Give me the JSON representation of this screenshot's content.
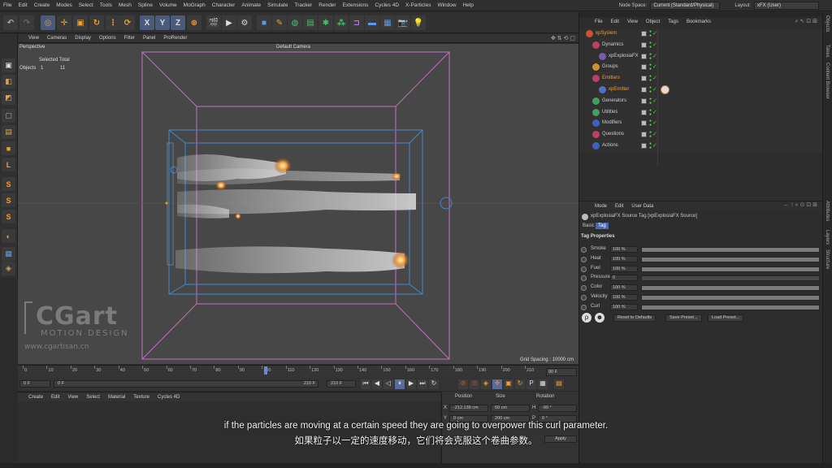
{
  "menubar": {
    "items": [
      "File",
      "Edit",
      "Create",
      "Modes",
      "Select",
      "Tools",
      "Mesh",
      "Spline",
      "Volume",
      "MoGraph",
      "Character",
      "Animate",
      "Simulate",
      "Tracker",
      "Render",
      "Extensions",
      "Cycles 4D",
      "X-Particles",
      "Window",
      "Help"
    ],
    "node_space_label": "Node Space:",
    "node_space_value": "Current (Standard/Physical)",
    "layout_label": "Layout:",
    "layout_value": "xFX (User)"
  },
  "toolbar": {
    "axis_labels": [
      "X",
      "Y",
      "Z"
    ]
  },
  "viewport": {
    "menu": [
      "View",
      "Cameras",
      "Display",
      "Options",
      "Filter",
      "Panel",
      "ProRender"
    ],
    "name": "Perspective",
    "camera": "Default Camera",
    "stats_header": "Selected Total",
    "stats_row_label": "Objects",
    "stats_selected": "1",
    "stats_total": "11",
    "grid_spacing": "Grid Spacing : 10000 cm"
  },
  "watermark": {
    "brand": "CGart",
    "tagline": "MOTION DESIGN",
    "url": "www.cgartisan.cn"
  },
  "timeline": {
    "ticks": [
      "0",
      "10",
      "20",
      "30",
      "40",
      "50",
      "60",
      "70",
      "80",
      "90",
      "100",
      "110",
      "120",
      "130",
      "140",
      "150",
      "160",
      "170",
      "180",
      "190",
      "200",
      "210"
    ],
    "current_frame_readout": "90 F",
    "start_frame": "0 F",
    "current_frame": "0 F",
    "end_frame": "210 F",
    "end_frame2": "210 F"
  },
  "bottom_menu": [
    "Create",
    "Edit",
    "View",
    "Select",
    "Material",
    "Texture",
    "Cycles 4D"
  ],
  "coords": {
    "headers": [
      "Position",
      "Size",
      "Rotation"
    ],
    "x_pos": "-212.139 cm",
    "x_size": "50 cm",
    "h_rot": "-90 °",
    "y_pos": "0 cm",
    "y_size": "200 cm",
    "p_rot": "0 °",
    "apply": "Apply"
  },
  "object_manager": {
    "menu": [
      "File",
      "Edit",
      "View",
      "Object",
      "Tags",
      "Bookmarks"
    ],
    "objects": [
      {
        "name": "xpSystem",
        "color": "#e8a040",
        "icon_color": "#d05030"
      },
      {
        "name": "Dynamics",
        "color": "#cfcfcf",
        "icon_color": "#c04060"
      },
      {
        "name": "xpExplosiaFX",
        "color": "#cfcfcf",
        "icon_color": "#7a5ab0"
      },
      {
        "name": "Groups",
        "color": "#cfcfcf",
        "icon_color": "#d09030"
      },
      {
        "name": "Emitters",
        "color": "#e8a040",
        "icon_color": "#c04060"
      },
      {
        "name": "xpEmitter",
        "color": "#e8a040",
        "icon_color": "#5070c0"
      },
      {
        "name": "Generators",
        "color": "#cfcfcf",
        "icon_color": "#40a060"
      },
      {
        "name": "Utilities",
        "color": "#cfcfcf",
        "icon_color": "#40a060"
      },
      {
        "name": "Modifiers",
        "color": "#cfcfcf",
        "icon_color": "#4060c0"
      },
      {
        "name": "Questions",
        "color": "#cfcfcf",
        "icon_color": "#c04060"
      },
      {
        "name": "Actions",
        "color": "#cfcfcf",
        "icon_color": "#4060c0"
      }
    ]
  },
  "attributes": {
    "menu": [
      "Mode",
      "Edit",
      "User Data"
    ],
    "tag_title": "xpExplosiaFX Source Tag [xpExplosiaFX Source]",
    "tabs": [
      "Basic",
      "Tag"
    ],
    "section": "Tag Properties",
    "props": [
      {
        "label": "Smoke",
        "value": "100 %",
        "fill": 1.0
      },
      {
        "label": "Heat",
        "value": "100 %",
        "fill": 1.0
      },
      {
        "label": "Fuel",
        "value": "100 %",
        "fill": 1.0
      },
      {
        "label": "Pressure",
        "value": "0",
        "fill": 0.0
      },
      {
        "label": "Color",
        "value": "100 %",
        "fill": 1.0
      },
      {
        "label": "Velocity",
        "value": "100 %",
        "fill": 1.0
      },
      {
        "label": "Curl",
        "value": "100 %",
        "fill": 1.0
      }
    ],
    "buttons": [
      "Reset to Defaults",
      "Save Preset...",
      "Load Preset..."
    ]
  },
  "side_tabs": [
    "Objects",
    "Takes",
    "Content Browser",
    "Attributes",
    "Layers",
    "Structure"
  ],
  "subtitles": {
    "en": "if the particles are moving at a certain speed they are going to overpower this curl parameter.",
    "zh": "如果粒子以一定的速度移动，它们将会克服这个卷曲参数。"
  }
}
